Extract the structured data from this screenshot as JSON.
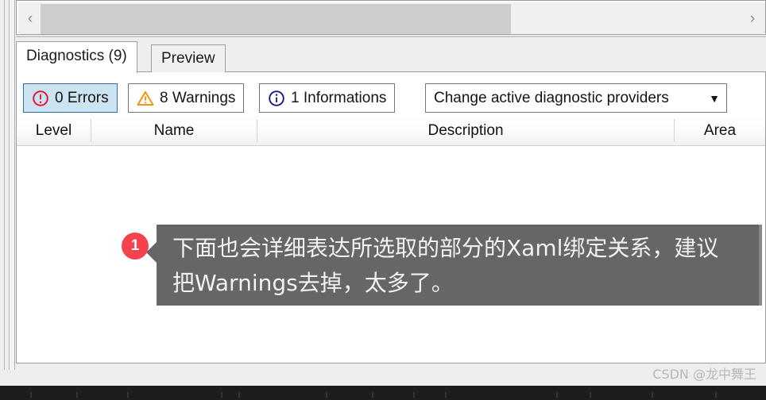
{
  "scrollbar": {
    "left_arrow": "‹",
    "right_arrow": "›",
    "left_icon_name": "chevron-left-icon",
    "right_icon_name": "chevron-right-icon"
  },
  "tabs": [
    {
      "label": "Diagnostics (9)",
      "active": true
    },
    {
      "label": "Preview",
      "active": false
    }
  ],
  "toolbar": {
    "errors": {
      "label": "0 Errors",
      "count": 0,
      "icon": "error-circle-icon",
      "color": "#e8112d",
      "selected": true
    },
    "warnings": {
      "label": "8 Warnings",
      "count": 8,
      "icon": "warning-triangle-icon",
      "color": "#f29100",
      "selected": false
    },
    "informations": {
      "label": "1 Informations",
      "count": 1,
      "icon": "info-circle-icon",
      "color": "#1a1a8c",
      "selected": false
    },
    "provider_select": {
      "value": "Change active diagnostic providers",
      "caret": "▼"
    }
  },
  "grid": {
    "columns": [
      {
        "label": "Level"
      },
      {
        "label": "Name"
      },
      {
        "label": "Description"
      },
      {
        "label": "Area"
      }
    ],
    "rows": []
  },
  "annotation": {
    "badge": "1",
    "badge_color": "#f4434d",
    "text": "下面也会详细表达所选取的部分的Xaml绑定关系，建议把Warnings去掉，太多了。",
    "background": "#666666"
  },
  "watermark": {
    "text": "CSDN @龙中舞王"
  }
}
